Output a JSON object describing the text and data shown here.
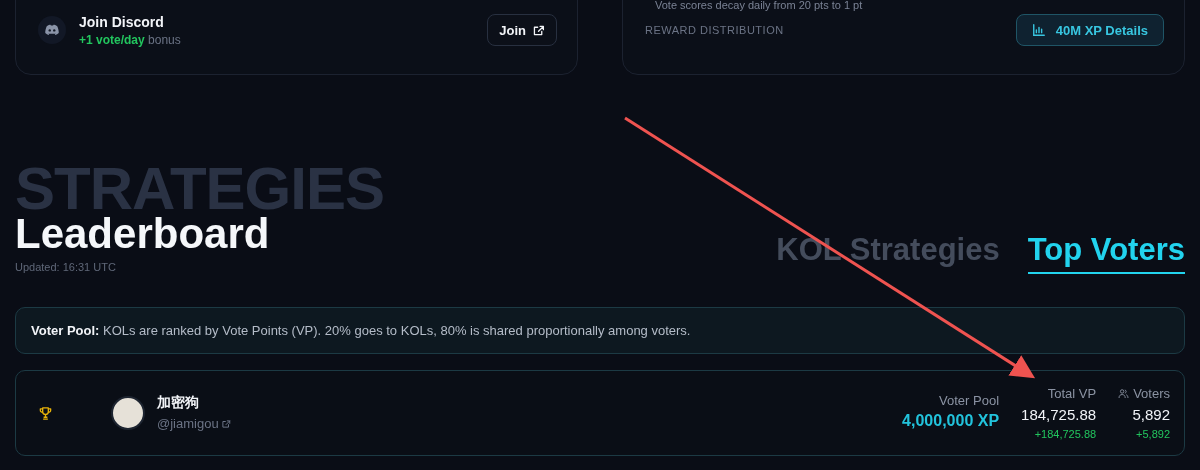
{
  "discord_card": {
    "title": "Join Discord",
    "bonus": "+1 vote/day",
    "bonus_suffix": "bonus",
    "button": "Join"
  },
  "reward_card": {
    "note": "Vote scores decay daily from 20 pts to 1 pt",
    "label": "REWARD DISTRIBUTION",
    "button": "40M XP Details"
  },
  "header": {
    "backdrop_title": "STRATEGIES",
    "title": "Leaderboard",
    "updated": "Updated: 16:31 UTC"
  },
  "tabs": [
    {
      "label": "KOL Strategies",
      "selected": false
    },
    {
      "label": "Top Voters",
      "selected": true
    }
  ],
  "info": "**Voter Pool:** KOLs are ranked by Vote Points (VP). 20% goes to KOLs, 80% is shared proportionally among voters.",
  "rows": [
    {
      "name": "加密狗",
      "handle": "@jiamigou",
      "pool_label": "Voter Pool",
      "pool_value": "4,000,000 XP",
      "stats": [
        {
          "kind": "plain",
          "label": "Total VP",
          "value": "184,725.88",
          "delta": "+184,725.88"
        },
        {
          "kind": "people",
          "label": "Voters",
          "value": "5,892",
          "delta": "+5,892"
        }
      ]
    }
  ]
}
